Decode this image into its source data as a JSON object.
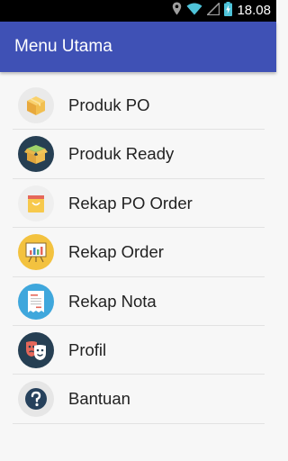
{
  "status_bar": {
    "time": "18.08",
    "icons": [
      "location-icon",
      "wifi-icon",
      "signal-icon",
      "battery-charging-icon"
    ]
  },
  "app_bar": {
    "title": "Menu Utama",
    "color": "#3f51b5"
  },
  "menu": {
    "items": [
      {
        "label": "Produk PO",
        "icon": "box-icon"
      },
      {
        "label": "Produk Ready",
        "icon": "open-box-icon"
      },
      {
        "label": "Rekap PO Order",
        "icon": "shopping-bag-icon"
      },
      {
        "label": "Rekap Order",
        "icon": "presentation-chart-icon"
      },
      {
        "label": "Rekap Nota",
        "icon": "receipt-icon"
      },
      {
        "label": "Profil",
        "icon": "theater-masks-icon"
      },
      {
        "label": "Bantuan",
        "icon": "help-icon"
      }
    ]
  }
}
